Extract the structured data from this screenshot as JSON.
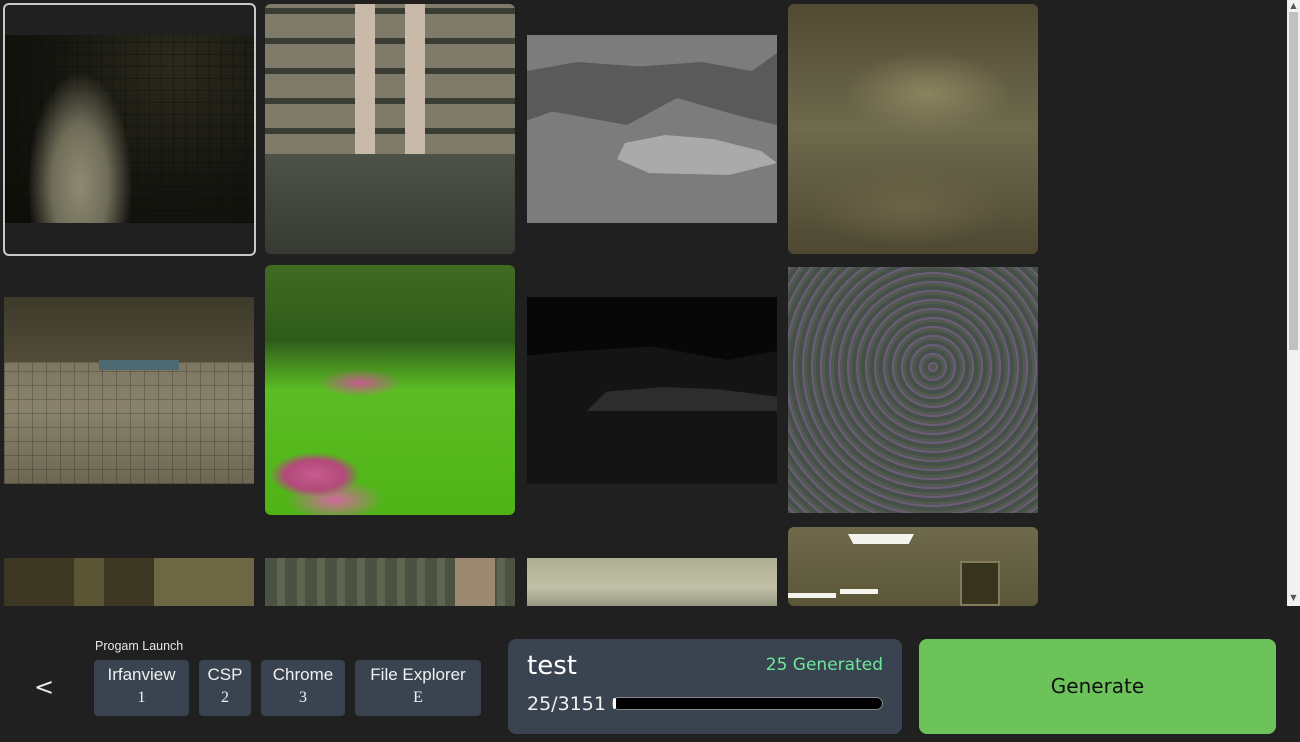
{
  "gallery": {
    "images": [
      {
        "name": "cylindrical-tiled-pillar"
      },
      {
        "name": "atrium-balconies"
      },
      {
        "name": "gray-depth-map"
      },
      {
        "name": "blurred-olive-texture"
      },
      {
        "name": "tiled-pool-corridor"
      },
      {
        "name": "green-garden-lawn"
      },
      {
        "name": "dark-depth-map"
      },
      {
        "name": "psychedelic-noise-pattern"
      },
      {
        "name": "dim-hallway"
      },
      {
        "name": "glass-walkway"
      },
      {
        "name": "pale-blurry-room"
      },
      {
        "name": "office-room-with-door"
      }
    ]
  },
  "bottom": {
    "back_label": "<",
    "launch_title": "Progam Launch",
    "launch_buttons": [
      {
        "name": "Irfanview",
        "key": "1"
      },
      {
        "name": "CSP",
        "key": "2"
      },
      {
        "name": "Chrome",
        "key": "3"
      },
      {
        "name": "File Explorer",
        "key": "E"
      }
    ],
    "status": {
      "job_name": "test",
      "generated_label": "25 Generated",
      "progress_text": "25/3151",
      "progress_fraction": 0.0079
    },
    "generate_label": "Generate"
  },
  "scrollbar": {
    "up": "▲",
    "down": "▼"
  },
  "colors": {
    "background": "#202020",
    "panel": "#3a4350",
    "accent_green": "#6bc35a",
    "generated_text": "#6de89a"
  }
}
